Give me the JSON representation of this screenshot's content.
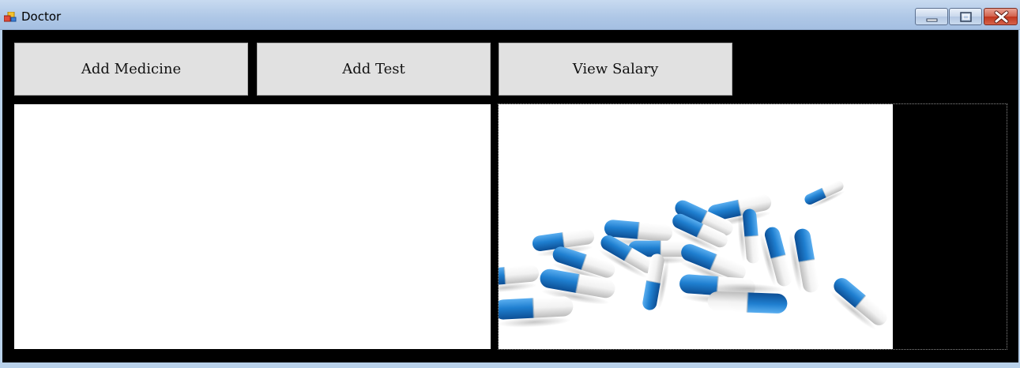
{
  "window": {
    "title": "Doctor",
    "icons": {
      "app": "app-form-icon",
      "minimize": "minimize-icon",
      "maximize": "maximize-icon",
      "close": "close-icon"
    }
  },
  "toolbar": {
    "add_medicine_label": "Add Medicine",
    "add_test_label": "Add Test",
    "view_salary_label": "View Salary"
  },
  "image": {
    "subject": "blue-and-white-capsule-pills"
  },
  "colors": {
    "client_background": "#000000",
    "button_face": "#e1e1e1",
    "pill_blue": "#1f7fd0",
    "pill_white": "#f2f2f2"
  }
}
